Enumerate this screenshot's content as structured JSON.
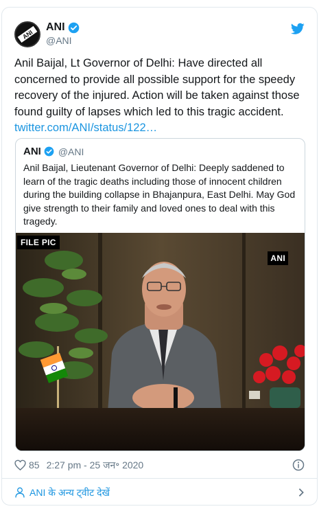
{
  "author": {
    "name": "ANI",
    "handle": "@ANI",
    "avatar_text": "ANI"
  },
  "tweet": {
    "text": "Anil Baijal, Lt Governor of Delhi: Have directed all concerned to provide all possible support for the speedy recovery of the injured. Action will be taken against those found guilty of lapses which led to this tragic accident.",
    "link": "twitter.com/ANI/status/122…"
  },
  "quoted": {
    "name": "ANI",
    "handle": "@ANI",
    "text": "Anil Baijal, Lieutenant Governor of Delhi: Deeply saddened to learn of the tragic deaths including those of innocent children during the building collapse in Bhajanpura, East Delhi. May God give strength to their family and loved ones to deal with this tragedy.",
    "image": {
      "badge_left": "FILE PIC",
      "badge_right": "ANI"
    }
  },
  "footer": {
    "likes": "85",
    "timestamp": "2:27 pm - 25 जन॰ 2020"
  },
  "more_tweets": {
    "label": "ANI के अन्य ट्वीट देखें"
  },
  "colors": {
    "link": "#1b95e0",
    "verified": "#1da1f2",
    "muted": "#657786",
    "border": "#e1e8ed"
  },
  "icons": [
    "ani-logo-avatar",
    "verified-badge-icon",
    "twitter-bird-icon",
    "heart-icon",
    "info-icon",
    "person-icon",
    "chevron-right-icon"
  ]
}
